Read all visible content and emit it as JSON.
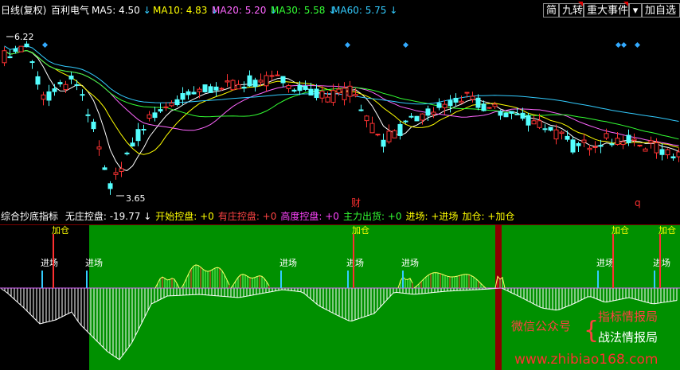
{
  "header": {
    "period": "日线(复权)",
    "stock_name": "百利电气",
    "ma": [
      {
        "label": "MA5: 4.50",
        "color": "#ffffff"
      },
      {
        "label": "MA10: 4.83",
        "color": "#ffff00"
      },
      {
        "label": "MA20: 5.20",
        "color": "#ff66ff"
      },
      {
        "label": "MA30: 5.58",
        "color": "#33ff33"
      },
      {
        "label": "MA60: 5.75",
        "color": "#33ccff"
      }
    ],
    "arrow": "↓",
    "buttons": {
      "simple": "简",
      "nine_turn": "九转",
      "major_events": "重大事件",
      "dropdown": "▾",
      "add_watch": "加自选"
    }
  },
  "main_chart": {
    "high_label": "6.22",
    "low_label": "3.65",
    "event_markers": {
      "finance": "财",
      "q": "q"
    },
    "price_range": [
      3.4,
      6.6
    ]
  },
  "indicator": {
    "name": "综合抄底指标",
    "items": [
      {
        "label": "无庄控盘: -19.77",
        "color": "#ffffff",
        "arrow": true
      },
      {
        "label": "开始控盘: +0",
        "color": "#ffff00"
      },
      {
        "label": "有庄控盘: +0",
        "color": "#ff4444"
      },
      {
        "label": "高度控盘: +0",
        "color": "#ff44ff"
      },
      {
        "label": "主力出货: +0",
        "color": "#33ff33"
      },
      {
        "label": "进场: +进场",
        "color": "#ffff00"
      },
      {
        "label": "加仓: +加仓",
        "color": "#ffff00"
      }
    ],
    "signal_enter": "进场",
    "signal_add": "加仓"
  },
  "watermark": {
    "wechat": "微信公众号",
    "brace": "{",
    "line1": "指标情报局",
    "line2": "战法情报局",
    "site": "www.zhibiao168.com"
  }
}
